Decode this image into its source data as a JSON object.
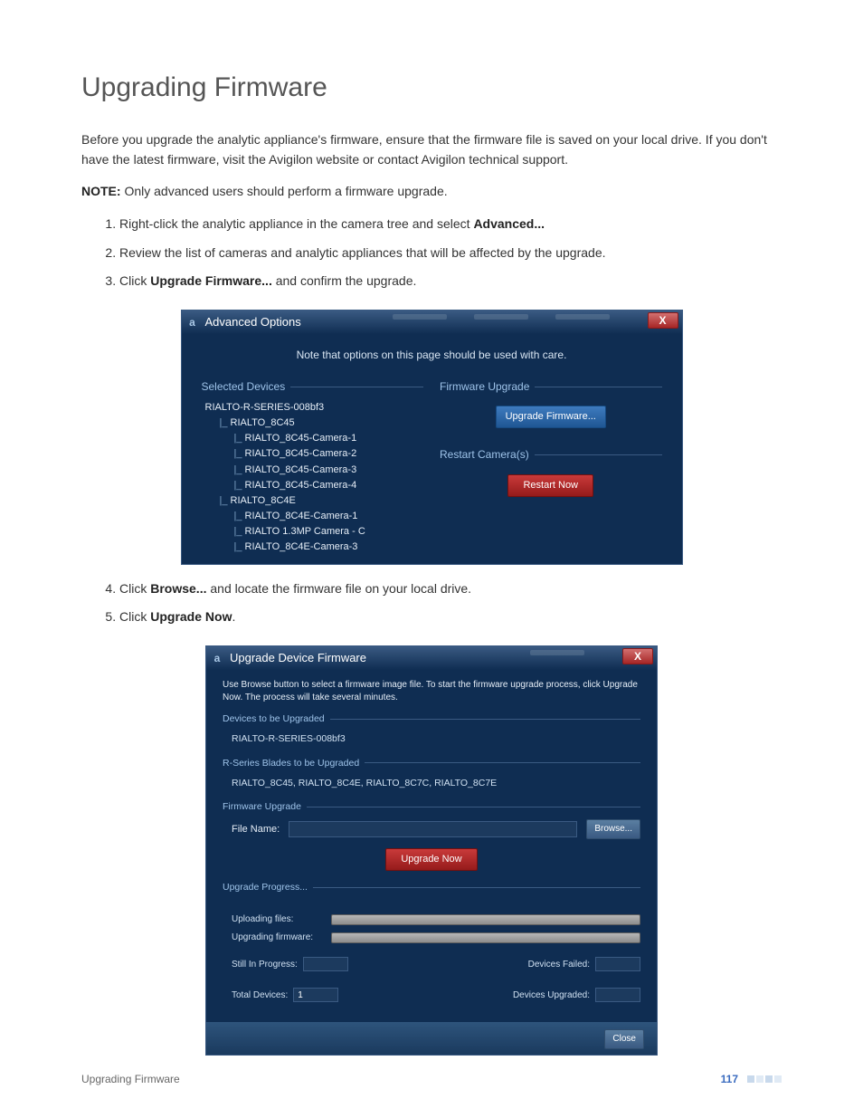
{
  "heading": "Upgrading Firmware",
  "para1": "Before you upgrade the analytic appliance's firmware, ensure that the firmware file is saved on your local drive. If you don't have the latest firmware, visit the Avigilon website or contact Avigilon technical support.",
  "note_label": "NOTE:",
  "note_text": " Only advanced users should perform a firmware upgrade.",
  "steps": {
    "s1_a": "Right-click the analytic appliance in the camera tree and select ",
    "s1_b": "Advanced...",
    "s2": "Review the list of cameras and analytic appliances that will be affected by the upgrade.",
    "s3_a": "Click ",
    "s3_b": "Upgrade Firmware...",
    "s3_c": " and confirm the upgrade.",
    "s4_a": "Click ",
    "s4_b": "Browse...",
    "s4_c": " and locate the firmware file on your local drive.",
    "s5_a": "Click ",
    "s5_b": "Upgrade Now",
    "s5_c": "."
  },
  "dialog1": {
    "title": "Advanced Options",
    "close": "X",
    "note": "Note that options on this page should be used with care.",
    "selected_devices_title": "Selected Devices",
    "tree": {
      "n0": "RIALTO-R-SERIES-008bf3",
      "n1": "RIALTO_8C45",
      "n1a": "RIALTO_8C45-Camera-1",
      "n1b": "RIALTO_8C45-Camera-2",
      "n1c": "RIALTO_8C45-Camera-3",
      "n1d": "RIALTO_8C45-Camera-4",
      "n2": "RIALTO_8C4E",
      "n2a": "RIALTO_8C4E-Camera-1",
      "n2b": "RIALTO 1.3MP Camera - C",
      "n2c": "RIALTO_8C4E-Camera-3"
    },
    "fw_title": "Firmware Upgrade",
    "fw_btn": "Upgrade Firmware...",
    "restart_title": "Restart Camera(s)",
    "restart_btn": "Restart Now"
  },
  "dialog2": {
    "title": "Upgrade Device Firmware",
    "close": "X",
    "instr": "Use Browse button to select a firmware image file.  To start the firmware upgrade process, click Upgrade Now.  The process will take several minutes.",
    "devices_title": "Devices to be Upgraded",
    "devices_val": "RIALTO-R-SERIES-008bf3",
    "blades_title": "R-Series Blades to be Upgraded",
    "blades_val": "RIALTO_8C45, RIALTO_8C4E, RIALTO_8C7C, RIALTO_8C7E",
    "fw_title": "Firmware Upgrade",
    "file_label": "File Name:",
    "browse_btn": "Browse...",
    "upgrade_now_btn": "Upgrade Now",
    "progress_title": "Upgrade Progress...",
    "uploading_label": "Uploading files:",
    "upgrading_label": "Upgrading firmware:",
    "still_in_progress_label": "Still In Progress:",
    "total_devices_label": "Total Devices:",
    "total_devices_val": "1",
    "devices_failed_label": "Devices Failed:",
    "devices_upgraded_label": "Devices Upgraded:",
    "close_btn": "Close"
  },
  "footer": {
    "left": "Upgrading Firmware",
    "page_num": "117"
  }
}
